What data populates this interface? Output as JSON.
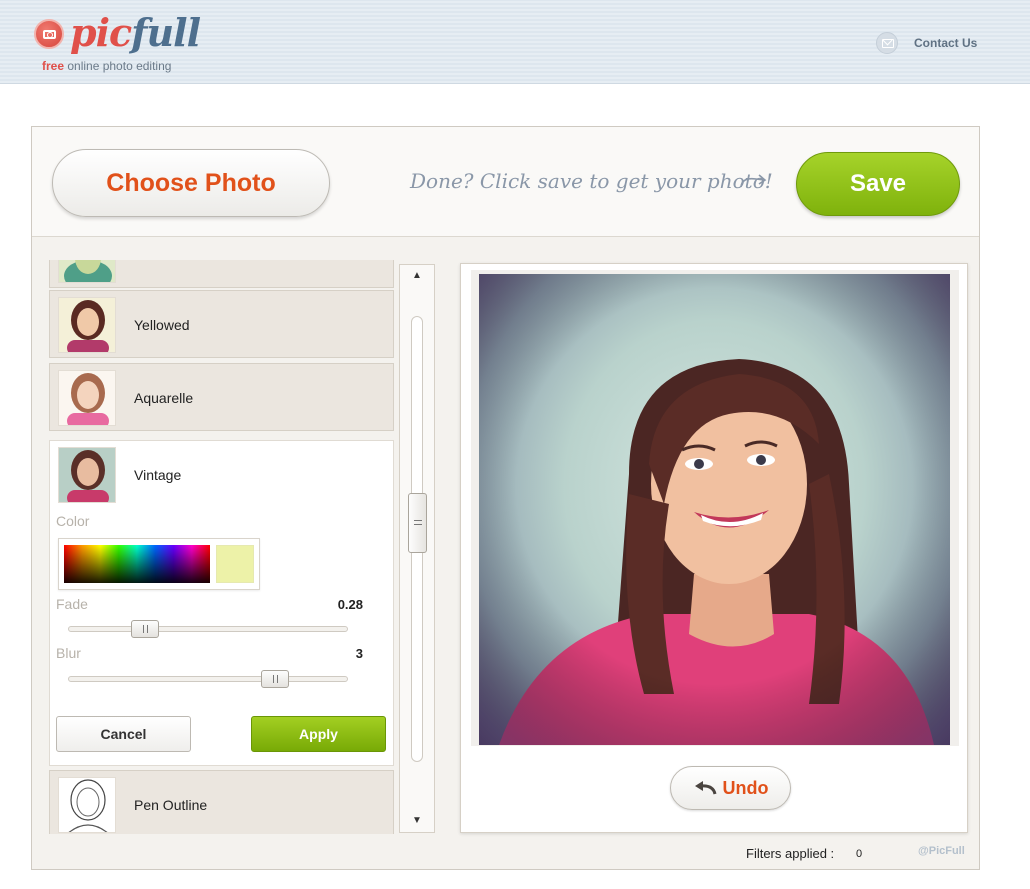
{
  "header": {
    "logo_pic": "pic",
    "logo_full": "full",
    "tagline_free": "free",
    "tagline_rest": " online photo editing",
    "contact_label": "Contact Us"
  },
  "toolbar": {
    "choose_label": "Choose Photo",
    "hint": "Done? Click save to get your photo!",
    "save_label": "Save"
  },
  "filters": {
    "items": [
      {
        "label": "Yellowed"
      },
      {
        "label": "Aquarelle"
      },
      {
        "label": "Vintage"
      },
      {
        "label": "Pen Outline"
      }
    ],
    "open": {
      "color_label": "Color",
      "selected_color": "#edf2a8",
      "fade_label": "Fade",
      "fade_value": "0.28",
      "blur_label": "Blur",
      "blur_value": "3",
      "cancel_label": "Cancel",
      "apply_label": "Apply"
    }
  },
  "preview": {
    "undo_label": "Undo"
  },
  "footer": {
    "filters_applied_label": "Filters applied :",
    "filters_applied_count": "0",
    "credit": "@PicFull"
  },
  "colors": {
    "accent_orange": "#e1511a",
    "accent_green": "#8cc11a",
    "logo_red": "#e0504a",
    "logo_blue": "#4e6f8e"
  }
}
